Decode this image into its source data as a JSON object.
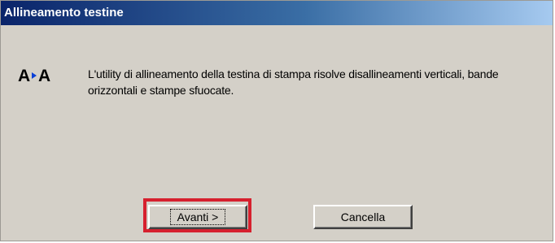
{
  "window": {
    "title": "Allineamento testine"
  },
  "icon": {
    "name": "align-heads-icon",
    "accent": "#0a3fd6"
  },
  "message": "L'utility di allineamento della testina di stampa risolve disallineamenti verticali, bande orizzontali e stampe sfuocate.",
  "buttons": {
    "next": "Avanti >",
    "cancel": "Cancella"
  },
  "colors": {
    "title_bar_start": "#0a246a",
    "title_bar_end": "#a6caf0",
    "dialog_bg": "#d4d0c8",
    "highlight": "#d6202e"
  }
}
